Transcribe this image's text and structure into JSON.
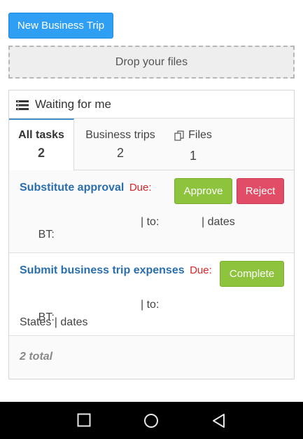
{
  "toolbar": {
    "new_trip_label": "New Business Trip"
  },
  "dropzone": {
    "label": "Drop your files"
  },
  "panel": {
    "title": "Waiting for me",
    "tabs": [
      {
        "label": "All tasks",
        "count": "2"
      },
      {
        "label": "Business trips",
        "count": "2"
      },
      {
        "label": "Files",
        "count": "1"
      }
    ]
  },
  "tasks": [
    {
      "title": "Substitute approval",
      "due": "Due:",
      "actions": {
        "approve": "Approve",
        "reject": "Reject"
      },
      "bt_label": "BT:",
      "to_part": "| to:",
      "dates_part": "| dates"
    },
    {
      "title": "Submit business trip expenses",
      "due": "Due:",
      "actions": {
        "complete": "Complete"
      },
      "bt_label": "BT:",
      "to_part": "| to:",
      "second_line": "States | dates"
    }
  ],
  "footer": {
    "total": "2 total"
  },
  "icons": [
    "list-icon",
    "files-icon",
    "square-icon",
    "circle-icon",
    "back-triangle-icon"
  ],
  "colors": {
    "primary": "#2f9ff3",
    "approve": "#8ec33d",
    "reject": "#e14d66",
    "link": "#2a6fad",
    "due": "#d9262b"
  }
}
